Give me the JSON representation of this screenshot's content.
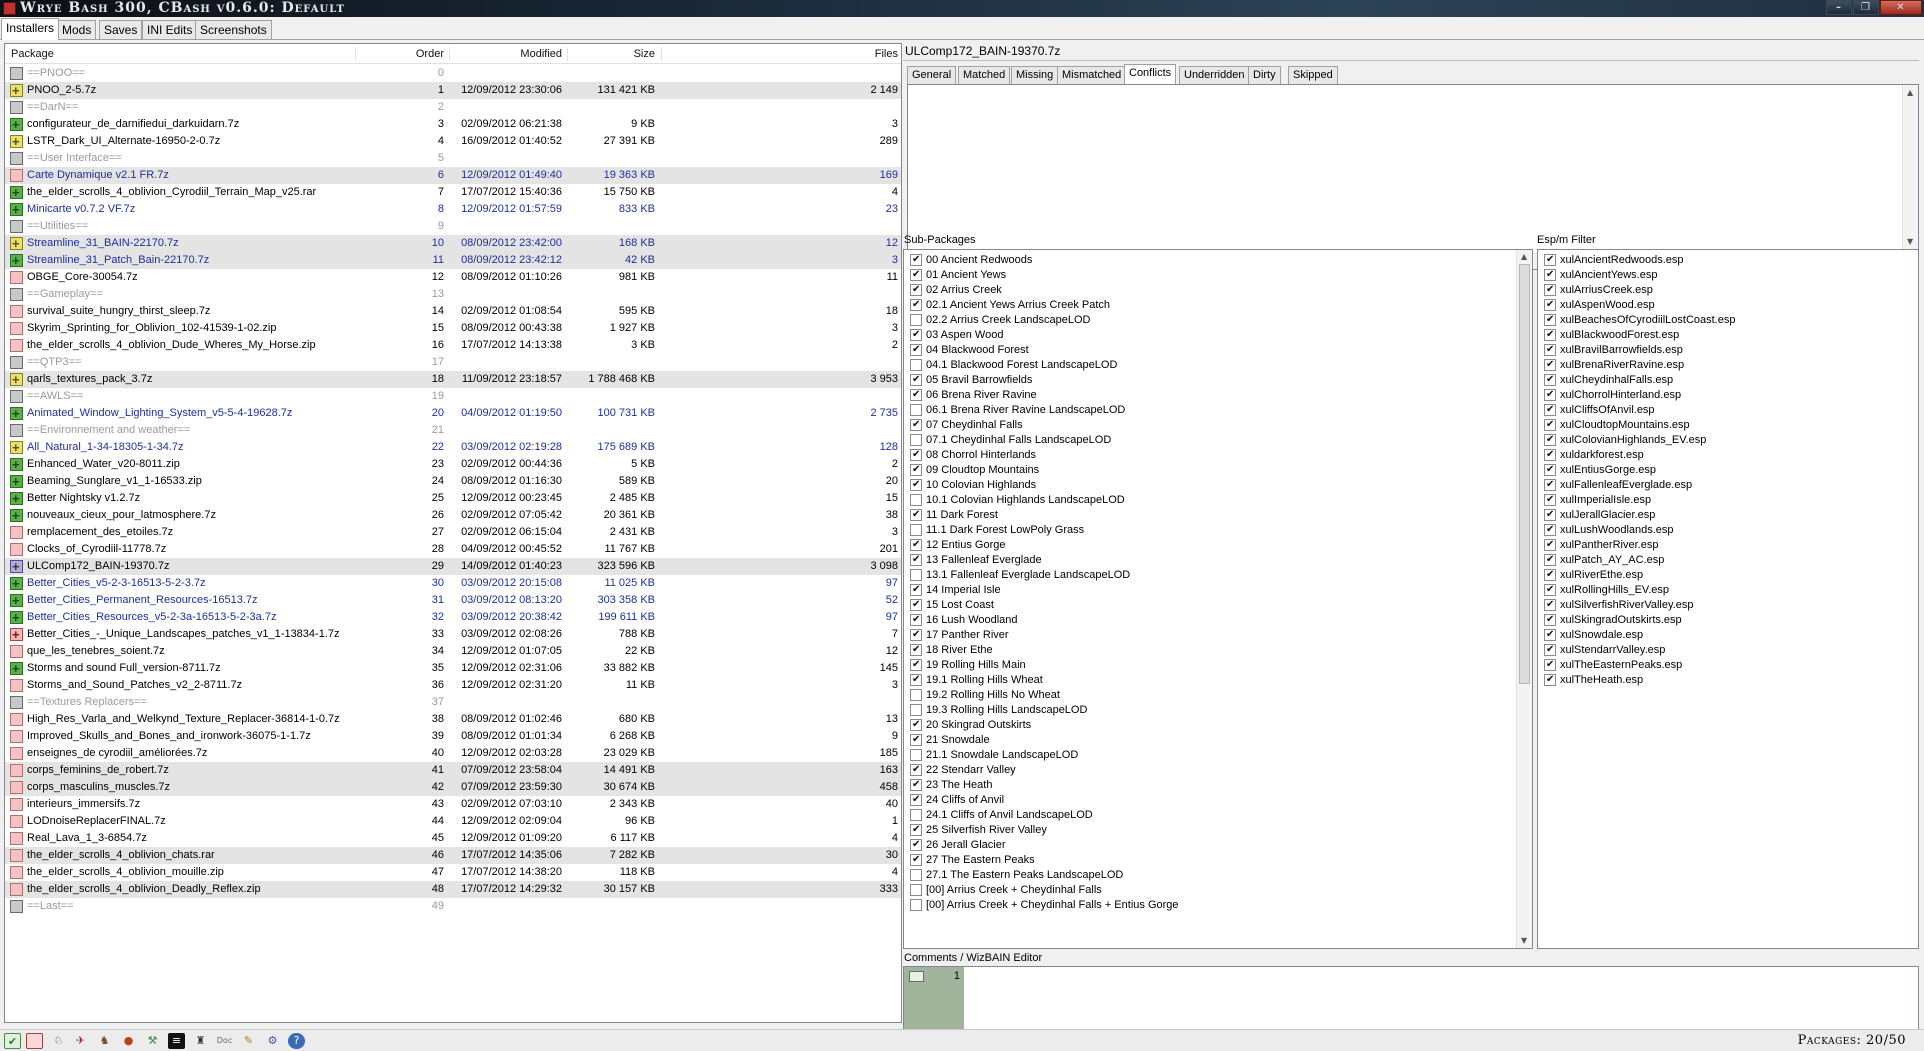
{
  "window": {
    "title": "Wrye Bash 300, CBash v0.6.0: Default"
  },
  "main_tabs": [
    "Installers",
    "Mods",
    "Saves",
    "INI Edits",
    "Screenshots"
  ],
  "columns": {
    "package": "Package",
    "order": "Order",
    "modified": "Modified",
    "size": "Size",
    "files": "Files"
  },
  "packages": [
    {
      "name": "==PNOO==",
      "order": "0",
      "modified": "",
      "size": "",
      "files": "",
      "icon": "gray",
      "marker": true
    },
    {
      "name": "PNOO_2-5.7z",
      "order": "1",
      "modified": "12/09/2012 23:30:06",
      "size": "131 421 KB",
      "files": "2 149",
      "icon": "yellow",
      "shade": true
    },
    {
      "name": "==DarN==",
      "order": "2",
      "modified": "",
      "size": "",
      "files": "",
      "icon": "gray",
      "marker": true
    },
    {
      "name": "configurateur_de_darnifiedui_darkuidarn.7z",
      "order": "3",
      "modified": "02/09/2012 06:21:38",
      "size": "9 KB",
      "files": "3",
      "icon": "green"
    },
    {
      "name": "LSTR_Dark_UI_Alternate-16950-2-0.7z",
      "order": "4",
      "modified": "16/09/2012 01:40:52",
      "size": "27 391 KB",
      "files": "289",
      "icon": "yellow"
    },
    {
      "name": "==User Interface==",
      "order": "5",
      "modified": "",
      "size": "",
      "files": "",
      "icon": "gray",
      "marker": true
    },
    {
      "name": "Carte Dynamique v2.1 FR.7z",
      "order": "6",
      "modified": "12/09/2012 01:49:40",
      "size": "19 363 KB",
      "files": "169",
      "icon": "pink",
      "shade": true,
      "blue": true
    },
    {
      "name": "the_elder_scrolls_4_oblivion_Cyrodiil_Terrain_Map_v25.rar",
      "order": "7",
      "modified": "17/07/2012 15:40:36",
      "size": "15 750 KB",
      "files": "4",
      "icon": "green"
    },
    {
      "name": "Minicarte v0.7.2 VF.7z",
      "order": "8",
      "modified": "12/09/2012 01:57:59",
      "size": "833 KB",
      "files": "23",
      "icon": "green",
      "blue": true
    },
    {
      "name": "==Utilities==",
      "order": "9",
      "modified": "",
      "size": "",
      "files": "",
      "icon": "gray",
      "marker": true
    },
    {
      "name": "Streamline_31_BAIN-22170.7z",
      "order": "10",
      "modified": "08/09/2012 23:42:00",
      "size": "168 KB",
      "files": "12",
      "icon": "yellow",
      "shade": true,
      "blue": true
    },
    {
      "name": "Streamline_31_Patch_Bain-22170.7z",
      "order": "11",
      "modified": "08/09/2012 23:42:12",
      "size": "42 KB",
      "files": "3",
      "icon": "green",
      "shade": true,
      "blue": true
    },
    {
      "name": "OBGE_Core-30054.7z",
      "order": "12",
      "modified": "08/09/2012 01:10:26",
      "size": "981 KB",
      "files": "11",
      "icon": "pink"
    },
    {
      "name": "==Gameplay==",
      "order": "13",
      "modified": "",
      "size": "",
      "files": "",
      "icon": "gray",
      "marker": true
    },
    {
      "name": "survival_suite_hungry_thirst_sleep.7z",
      "order": "14",
      "modified": "02/09/2012 01:08:54",
      "size": "595 KB",
      "files": "18",
      "icon": "pink"
    },
    {
      "name": "Skyrim_Sprinting_for_Oblivion_102-41539-1-02.zip",
      "order": "15",
      "modified": "08/09/2012 00:43:38",
      "size": "1 927 KB",
      "files": "3",
      "icon": "pink"
    },
    {
      "name": "the_elder_scrolls_4_oblivion_Dude_Wheres_My_Horse.zip",
      "order": "16",
      "modified": "17/07/2012 14:13:38",
      "size": "3 KB",
      "files": "2",
      "icon": "pink"
    },
    {
      "name": "==QTP3==",
      "order": "17",
      "modified": "",
      "size": "",
      "files": "",
      "icon": "gray",
      "marker": true
    },
    {
      "name": "qarls_textures_pack_3.7z",
      "order": "18",
      "modified": "11/09/2012 23:18:57",
      "size": "1 788 468 KB",
      "files": "3 953",
      "icon": "yellow",
      "shade": true
    },
    {
      "name": "==AWLS==",
      "order": "19",
      "modified": "",
      "size": "",
      "files": "",
      "icon": "gray",
      "marker": true
    },
    {
      "name": "Animated_Window_Lighting_System_v5-5-4-19628.7z",
      "order": "20",
      "modified": "04/09/2012 01:19:50",
      "size": "100 731 KB",
      "files": "2 735",
      "icon": "green",
      "blue": true
    },
    {
      "name": "==Environnement and weather==",
      "order": "21",
      "modified": "",
      "size": "",
      "files": "",
      "icon": "gray",
      "marker": true
    },
    {
      "name": "All_Natural_1-34-18305-1-34.7z",
      "order": "22",
      "modified": "03/09/2012 02:19:28",
      "size": "175 689 KB",
      "files": "128",
      "icon": "yellow",
      "blue": true
    },
    {
      "name": "Enhanced_Water_v20-8011.zip",
      "order": "23",
      "modified": "02/09/2012 00:44:36",
      "size": "5 KB",
      "files": "2",
      "icon": "green"
    },
    {
      "name": "Beaming_Sunglare_v1_1-16533.zip",
      "order": "24",
      "modified": "08/09/2012 01:16:30",
      "size": "589 KB",
      "files": "20",
      "icon": "green"
    },
    {
      "name": "Better Nightsky v1.2.7z",
      "order": "25",
      "modified": "12/09/2012 00:23:45",
      "size": "2 485 KB",
      "files": "15",
      "icon": "green"
    },
    {
      "name": "nouveaux_cieux_pour_latmosphere.7z",
      "order": "26",
      "modified": "02/09/2012 07:05:42",
      "size": "20 361 KB",
      "files": "38",
      "icon": "green"
    },
    {
      "name": "remplacement_des_etoiles.7z",
      "order": "27",
      "modified": "02/09/2012 06:15:04",
      "size": "2 431 KB",
      "files": "3",
      "icon": "pink"
    },
    {
      "name": "Clocks_of_Cyrodiil-11778.7z",
      "order": "28",
      "modified": "04/09/2012 00:45:52",
      "size": "11 767 KB",
      "files": "201",
      "icon": "pink"
    },
    {
      "name": "ULComp172_BAIN-19370.7z",
      "order": "29",
      "modified": "14/09/2012 01:40:23",
      "size": "323 596 KB",
      "files": "3 098",
      "icon": "purple",
      "shade": true
    },
    {
      "name": "Better_Cities_v5-2-3-16513-5-2-3.7z",
      "order": "30",
      "modified": "03/09/2012 20:15:08",
      "size": "11 025 KB",
      "files": "97",
      "icon": "green",
      "blue": true
    },
    {
      "name": "Better_Cities_Permanent_Resources-16513.7z",
      "order": "31",
      "modified": "03/09/2012 08:13:20",
      "size": "303 358 KB",
      "files": "52",
      "icon": "green",
      "blue": true
    },
    {
      "name": "Better_Cities_Resources_v5-2-3a-16513-5-2-3a.7z",
      "order": "32",
      "modified": "03/09/2012 20:38:42",
      "size": "199 611 KB",
      "files": "97",
      "icon": "green",
      "blue": true
    },
    {
      "name": "Better_Cities_-_Unique_Landscapes_patches_v1_1-13834-1.7z",
      "order": "33",
      "modified": "03/09/2012 02:08:26",
      "size": "788 KB",
      "files": "7",
      "icon": "red"
    },
    {
      "name": "que_les_tenebres_soient.7z",
      "order": "34",
      "modified": "12/09/2012 01:07:05",
      "size": "22 KB",
      "files": "12",
      "icon": "pink"
    },
    {
      "name": "Storms and sound Full_version-8711.7z",
      "order": "35",
      "modified": "12/09/2012 02:31:06",
      "size": "33 882 KB",
      "files": "145",
      "icon": "green"
    },
    {
      "name": "Storms_and_Sound_Patches_v2_2-8711.7z",
      "order": "36",
      "modified": "12/09/2012 02:31:20",
      "size": "11 KB",
      "files": "3",
      "icon": "pink"
    },
    {
      "name": "==Textures Replacers==",
      "order": "37",
      "modified": "",
      "size": "",
      "files": "",
      "icon": "gray",
      "marker": true
    },
    {
      "name": "High_Res_Varla_and_Welkynd_Texture_Replacer-36814-1-0.7z",
      "order": "38",
      "modified": "08/09/2012 01:02:46",
      "size": "680 KB",
      "files": "13",
      "icon": "pink"
    },
    {
      "name": "Improved_Skulls_and_Bones_and_ironwork-36075-1-1.7z",
      "order": "39",
      "modified": "08/09/2012 01:01:34",
      "size": "6 268 KB",
      "files": "9",
      "icon": "pink"
    },
    {
      "name": "enseignes_de cyrodiil_améliorées.7z",
      "order": "40",
      "modified": "12/09/2012 02:03:28",
      "size": "23 029 KB",
      "files": "185",
      "icon": "pink"
    },
    {
      "name": "corps_feminins_de_robert.7z",
      "order": "41",
      "modified": "07/09/2012 23:58:04",
      "size": "14 491 KB",
      "files": "163",
      "icon": "pink",
      "shade": true
    },
    {
      "name": "corps_masculins_muscles.7z",
      "order": "42",
      "modified": "07/09/2012 23:59:30",
      "size": "30 674 KB",
      "files": "458",
      "icon": "pink",
      "shade": true
    },
    {
      "name": "interieurs_immersifs.7z",
      "order": "43",
      "modified": "02/09/2012 07:03:10",
      "size": "2 343 KB",
      "files": "40",
      "icon": "pink"
    },
    {
      "name": "LODnoiseReplacerFINAL.7z",
      "order": "44",
      "modified": "12/09/2012 02:09:04",
      "size": "96 KB",
      "files": "1",
      "icon": "pink"
    },
    {
      "name": "Real_Lava_1_3-6854.7z",
      "order": "45",
      "modified": "12/09/2012 01:09:20",
      "size": "6 117 KB",
      "files": "4",
      "icon": "pink"
    },
    {
      "name": "the_elder_scrolls_4_oblivion_chats.rar",
      "order": "46",
      "modified": "17/07/2012 14:35:06",
      "size": "7 282 KB",
      "files": "30",
      "icon": "pink",
      "shade": true
    },
    {
      "name": "the_elder_scrolls_4_oblivion_mouille.zip",
      "order": "47",
      "modified": "17/07/2012 14:38:20",
      "size": "118 KB",
      "files": "4",
      "icon": "pink"
    },
    {
      "name": "the_elder_scrolls_4_oblivion_Deadly_Reflex.zip",
      "order": "48",
      "modified": "17/07/2012 14:29:32",
      "size": "30 157 KB",
      "files": "333",
      "icon": "pink",
      "shade": true
    },
    {
      "name": "==Last==",
      "order": "49",
      "modified": "",
      "size": "",
      "files": "",
      "icon": "gray",
      "marker": true
    }
  ],
  "detail": {
    "package_name": "ULComp172_BAIN-19370.7z",
    "tabs": [
      "General",
      "Matched",
      "Missing",
      "Mismatched",
      "Conflicts",
      "Underridden",
      "Dirty",
      "Skipped"
    ],
    "active_tab": "Conflicts",
    "sub_packages_label": "Sub-Packages",
    "esp_filter_label": "Esp/m Filter",
    "comments_label": "Comments / WizBAIN Editor",
    "comment_line": "1"
  },
  "sub_packages": [
    {
      "label": "00 Ancient Redwoods",
      "checked": true
    },
    {
      "label": "01 Ancient Yews",
      "checked": true
    },
    {
      "label": "02 Arrius Creek",
      "checked": true
    },
    {
      "label": "02.1 Ancient Yews Arrius Creek Patch",
      "checked": true
    },
    {
      "label": "02.2 Arrius Creek LandscapeLOD",
      "checked": false
    },
    {
      "label": "03 Aspen Wood",
      "checked": true
    },
    {
      "label": "04 Blackwood Forest",
      "checked": true
    },
    {
      "label": "04.1 Blackwood Forest LandscapeLOD",
      "checked": false
    },
    {
      "label": "05 Bravil Barrowfields",
      "checked": true
    },
    {
      "label": "06 Brena River Ravine",
      "checked": true
    },
    {
      "label": "06.1 Brena River Ravine LandscapeLOD",
      "checked": false
    },
    {
      "label": "07 Cheydinhal Falls",
      "checked": true
    },
    {
      "label": "07.1 Cheydinhal Falls LandscapeLOD",
      "checked": false
    },
    {
      "label": "08 Chorrol Hinterlands",
      "checked": true
    },
    {
      "label": "09 Cloudtop Mountains",
      "checked": true
    },
    {
      "label": "10 Colovian Highlands",
      "checked": true
    },
    {
      "label": "10.1 Colovian Highlands LandscapeLOD",
      "checked": false
    },
    {
      "label": "11 Dark Forest",
      "checked": true
    },
    {
      "label": "11.1 Dark Forest LowPoly Grass",
      "checked": false
    },
    {
      "label": "12 Entius Gorge",
      "checked": true
    },
    {
      "label": "13 Fallenleaf Everglade",
      "checked": true
    },
    {
      "label": "13.1 Fallenleaf Everglade LandscapeLOD",
      "checked": false
    },
    {
      "label": "14 Imperial Isle",
      "checked": true
    },
    {
      "label": "15 Lost Coast",
      "checked": true
    },
    {
      "label": "16 Lush Woodland",
      "checked": true
    },
    {
      "label": "17 Panther River",
      "checked": true
    },
    {
      "label": "18 River Ethe",
      "checked": true
    },
    {
      "label": "19 Rolling Hills Main",
      "checked": true
    },
    {
      "label": "19.1 Rolling Hills Wheat",
      "checked": true
    },
    {
      "label": "19.2 Rolling Hills No Wheat",
      "checked": false
    },
    {
      "label": "19.3 Rolling Hills LandscapeLOD",
      "checked": false
    },
    {
      "label": "20 Skingrad Outskirts",
      "checked": true
    },
    {
      "label": "21 Snowdale",
      "checked": true
    },
    {
      "label": "21.1 Snowdale LandscapeLOD",
      "checked": false
    },
    {
      "label": "22 Stendarr Valley",
      "checked": true
    },
    {
      "label": "23 The Heath",
      "checked": true
    },
    {
      "label": "24 Cliffs of Anvil",
      "checked": true
    },
    {
      "label": "24.1 Cliffs of Anvil LandscapeLOD",
      "checked": false
    },
    {
      "label": "25 Silverfish River Valley",
      "checked": true
    },
    {
      "label": "26 Jerall Glacier",
      "checked": true
    },
    {
      "label": "27 The Eastern Peaks",
      "checked": true
    },
    {
      "label": "27.1 The Eastern Peaks LandscapeLOD",
      "checked": false
    },
    {
      "label": "[00] Arrius Creek + Cheydinhal Falls",
      "checked": false
    },
    {
      "label": "[00] Arrius Creek + Cheydinhal Falls + Entius Gorge",
      "checked": false
    }
  ],
  "esp_filter": [
    "xulAncientRedwoods.esp",
    "xulAncientYews.esp",
    "xulArriusCreek.esp",
    "xulAspenWood.esp",
    "xulBeachesOfCyrodiilLostCoast.esp",
    "xulBlackwoodForest.esp",
    "xulBravilBarrowfields.esp",
    "xulBrenaRiverRavine.esp",
    "xulCheydinhalFalls.esp",
    "xulChorrolHinterland.esp",
    "xulCliffsOfAnvil.esp",
    "xulCloudtopMountains.esp",
    "xulColovianHighlands_EV.esp",
    "xuldarkforest.esp",
    "xulEntiusGorge.esp",
    "xulFallenleafEverglade.esp",
    "xulImperialIsle.esp",
    "xulJerallGlacier.esp",
    "xulLushWoodlands.esp",
    "xulPantherRiver.esp",
    "xulPatch_AY_AC.esp",
    "xulRiverEthe.esp",
    "xulRollingHills_EV.esp",
    "xulSilverfishRiverValley.esp",
    "xulSkingradOutskirts.esp",
    "xulSnowdale.esp",
    "xulStendarrValley.esp",
    "xulTheEasternPeaks.esp",
    "xulTheHeath.esp"
  ],
  "statusbar": {
    "packages": "Packages: 20/50"
  },
  "colors": {
    "marker_text": "#9a9a9a",
    "highlight_text": "#1d2f9c",
    "shade_row": "#e4e4e4",
    "comment_gutter": "#a0b59c"
  }
}
